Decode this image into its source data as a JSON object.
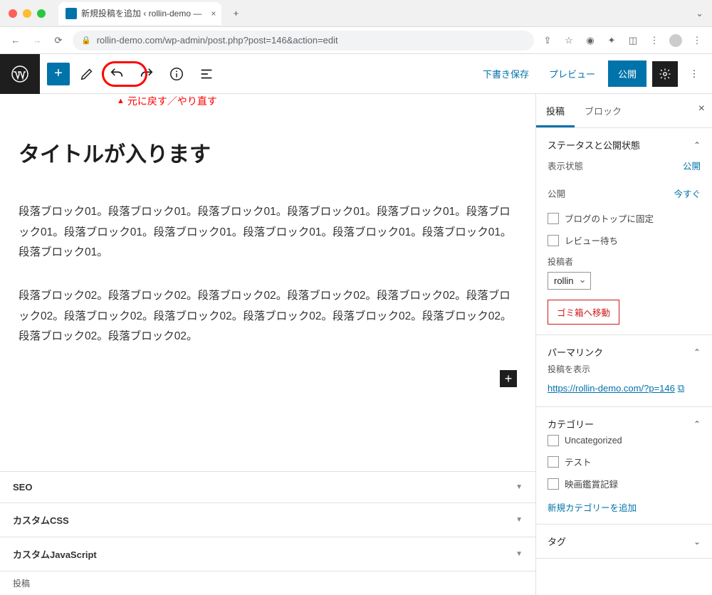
{
  "browser": {
    "tab_title": "新規投稿を追加 ‹ rollin-demo —",
    "url": "rollin-demo.com/wp-admin/post.php?post=146&action=edit"
  },
  "toolbar": {
    "save_draft": "下書き保存",
    "preview": "プレビュー",
    "publish": "公開"
  },
  "annotation": {
    "undo_redo": "元に戻す／やり直す"
  },
  "editor": {
    "title": "タイトルが入ります",
    "paragraphs": [
      "段落ブロック01。段落ブロック01。段落ブロック01。段落ブロック01。段落ブロック01。段落ブロック01。段落ブロック01。段落ブロック01。段落ブロック01。段落ブロック01。段落ブロック01。段落ブロック01。",
      "段落ブロック02。段落ブロック02。段落ブロック02。段落ブロック02。段落ブロック02。段落ブロック02。段落ブロック02。段落ブロック02。段落ブロック02。段落ブロック02。段落ブロック02。段落ブロック02。段落ブロック02。"
    ]
  },
  "meta_panels": [
    "SEO",
    "カスタムCSS",
    "カスタムJavaScript"
  ],
  "meta_footer": "投稿",
  "sidebar": {
    "tabs": {
      "post": "投稿",
      "block": "ブロック"
    },
    "status": {
      "title": "ステータスと公開状態",
      "visibility_label": "表示状態",
      "visibility_value": "公開",
      "publish_label": "公開",
      "publish_value": "今すぐ",
      "sticky": "ブログのトップに固定",
      "pending": "レビュー待ち",
      "author_label": "投稿者",
      "author_value": "rollin",
      "trash": "ゴミ箱へ移動"
    },
    "permalink": {
      "title": "パーマリンク",
      "show_label": "投稿を表示",
      "url": "https://rollin-demo.com/?p=146"
    },
    "categories": {
      "title": "カテゴリー",
      "items": [
        "Uncategorized",
        "テスト",
        "映画鑑賞記録"
      ],
      "add_new": "新規カテゴリーを追加"
    },
    "tags": {
      "title": "タグ"
    }
  }
}
